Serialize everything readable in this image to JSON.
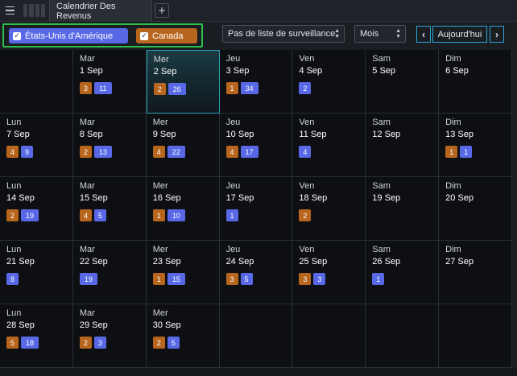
{
  "tabbar": {
    "tab_label": "Calendrier Des Revenus",
    "add_label": "+"
  },
  "toolbar": {
    "countries": [
      {
        "label": "États-Unis d'Amérique",
        "checked": true,
        "color": "#5868e6"
      },
      {
        "label": "Canada",
        "checked": true,
        "color": "#b8651e"
      }
    ],
    "watchlist_select": "Pas de liste de surveillance",
    "view_select": "Mois",
    "prev_label": "‹",
    "today_label": "Aujourd'hui",
    "next_label": "›"
  },
  "calendar": {
    "weeks": [
      [
        {
          "dow": "",
          "date": "",
          "ca": null,
          "us": null
        },
        {
          "dow": "Mar",
          "date": "1 Sep",
          "ca": "3",
          "us": "11"
        },
        {
          "dow": "Mer",
          "date": "2 Sep",
          "ca": "2",
          "us": "26",
          "today": true
        },
        {
          "dow": "Jeu",
          "date": "3 Sep",
          "ca": "1",
          "us": "34"
        },
        {
          "dow": "Ven",
          "date": "4 Sep",
          "ca": null,
          "us": "2"
        },
        {
          "dow": "Sam",
          "date": "5 Sep",
          "ca": null,
          "us": null
        },
        {
          "dow": "Dim",
          "date": "6 Sep",
          "ca": null,
          "us": null
        }
      ],
      [
        {
          "dow": "Lun",
          "date": "7 Sep",
          "ca": "4",
          "us": "9"
        },
        {
          "dow": "Mar",
          "date": "8 Sep",
          "ca": "2",
          "us": "13"
        },
        {
          "dow": "Mer",
          "date": "9 Sep",
          "ca": "4",
          "us": "22"
        },
        {
          "dow": "Jeu",
          "date": "10 Sep",
          "ca": "4",
          "us": "17"
        },
        {
          "dow": "Ven",
          "date": "11 Sep",
          "ca": null,
          "us": "4"
        },
        {
          "dow": "Sam",
          "date": "12 Sep",
          "ca": null,
          "us": null
        },
        {
          "dow": "Dim",
          "date": "13 Sep",
          "ca": "1",
          "us": "1"
        }
      ],
      [
        {
          "dow": "Lun",
          "date": "14 Sep",
          "ca": "2",
          "us": "19"
        },
        {
          "dow": "Mar",
          "date": "15 Sep",
          "ca": "4",
          "us": "5"
        },
        {
          "dow": "Mer",
          "date": "16 Sep",
          "ca": "1",
          "us": "10"
        },
        {
          "dow": "Jeu",
          "date": "17 Sep",
          "ca": null,
          "us": "1"
        },
        {
          "dow": "Ven",
          "date": "18 Sep",
          "ca": "2",
          "us": null
        },
        {
          "dow": "Sam",
          "date": "19 Sep",
          "ca": null,
          "us": null
        },
        {
          "dow": "Dim",
          "date": "20 Sep",
          "ca": null,
          "us": null
        }
      ],
      [
        {
          "dow": "Lun",
          "date": "21 Sep",
          "ca": null,
          "us": "8"
        },
        {
          "dow": "Mar",
          "date": "22 Sep",
          "ca": null,
          "us": "19"
        },
        {
          "dow": "Mer",
          "date": "23 Sep",
          "ca": "1",
          "us": "15"
        },
        {
          "dow": "Jeu",
          "date": "24 Sep",
          "ca": "3",
          "us": "5"
        },
        {
          "dow": "Ven",
          "date": "25 Sep",
          "ca": "3",
          "us": "3"
        },
        {
          "dow": "Sam",
          "date": "26 Sep",
          "ca": null,
          "us": "1"
        },
        {
          "dow": "Dim",
          "date": "27 Sep",
          "ca": null,
          "us": null
        }
      ],
      [
        {
          "dow": "Lun",
          "date": "28 Sep",
          "ca": "5",
          "us": "18"
        },
        {
          "dow": "Mar",
          "date": "29 Sep",
          "ca": "2",
          "us": "3"
        },
        {
          "dow": "Mer",
          "date": "30 Sep",
          "ca": "2",
          "us": "5"
        },
        {
          "dow": "",
          "date": "",
          "ca": null,
          "us": null
        },
        {
          "dow": "",
          "date": "",
          "ca": null,
          "us": null
        },
        {
          "dow": "",
          "date": "",
          "ca": null,
          "us": null
        },
        {
          "dow": "",
          "date": "",
          "ca": null,
          "us": null
        }
      ]
    ]
  }
}
